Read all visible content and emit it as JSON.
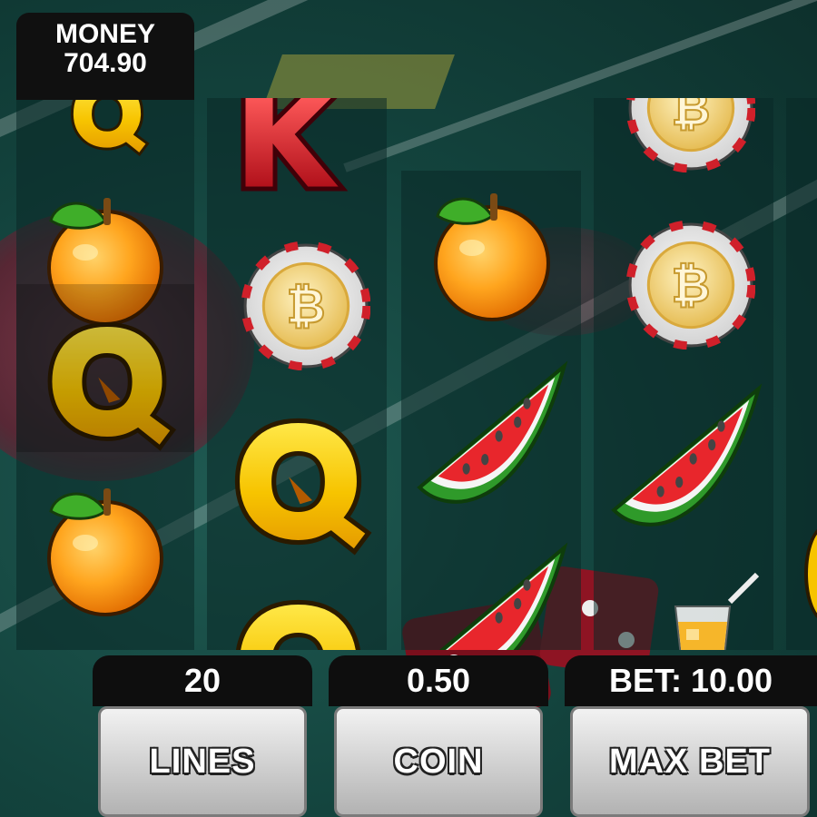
{
  "hud": {
    "money_label": "MONEY",
    "money_value": "704.90"
  },
  "controls": {
    "lines_value": "20",
    "lines_label": "LINES",
    "coin_value": "0.50",
    "coin_label": "COIN",
    "bet_value": "BET: 10.00",
    "maxbet_label": "MAX BET"
  },
  "reels": [
    [
      "Q",
      "orange",
      "Q",
      "orange"
    ],
    [
      "K",
      "bitcoin-chip",
      "Q",
      "Q"
    ],
    [
      "orange",
      "watermelon",
      "watermelon"
    ],
    [
      "bitcoin-chip",
      "bitcoin-chip",
      "watermelon",
      "juice"
    ],
    [
      "partial"
    ]
  ],
  "colors": {
    "panel_dark": "#0e0e0e",
    "button_gray": "#cfcfcf",
    "felt": "#13433d"
  }
}
